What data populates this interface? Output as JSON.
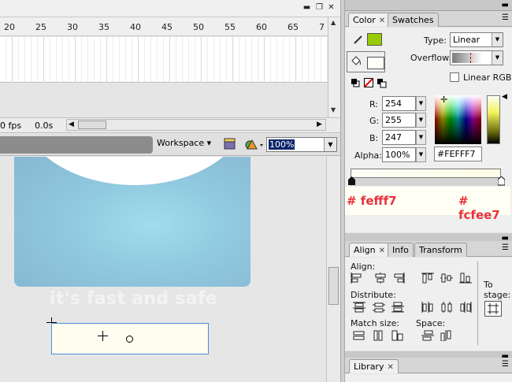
{
  "timeline": {
    "ruler_numbers": [
      "20",
      "25",
      "30",
      "35",
      "40",
      "45",
      "50",
      "55",
      "60",
      "65",
      "7"
    ],
    "fps": "0 fps",
    "time": "0.0s"
  },
  "toolbar": {
    "workspace_label": "Workspace ▾",
    "zoom_value": "100%"
  },
  "stage": {
    "tagline": "it's fast and safe"
  },
  "color_panel": {
    "tabs": [
      "Color",
      "Swatches"
    ],
    "type_label": "Type:",
    "type_value": "Linear",
    "overflow_label": "Overflow:",
    "linear_rgb_label": "Linear RGB",
    "r_label": "R:",
    "r_value": "254",
    "g_label": "G:",
    "g_value": "255",
    "b_label": "B:",
    "b_value": "247",
    "alpha_label": "Alpha:",
    "alpha_value": "100%",
    "hex_value": "#FEFFF7",
    "stop_left": "# fefff7",
    "stop_right": "# fcfee7",
    "colors": {
      "stroke": "#99cc00",
      "fill": "#fefff7",
      "annotation": "#e8313b"
    }
  },
  "align_panel": {
    "tabs": [
      "Align",
      "Info",
      "Transform"
    ],
    "align_label": "Align:",
    "distribute_label": "Distribute:",
    "match_size_label": "Match size:",
    "space_label": "Space:",
    "to_stage_label_1": "To",
    "to_stage_label_2": "stage:"
  },
  "library_panel": {
    "tabs": [
      "Library"
    ]
  }
}
